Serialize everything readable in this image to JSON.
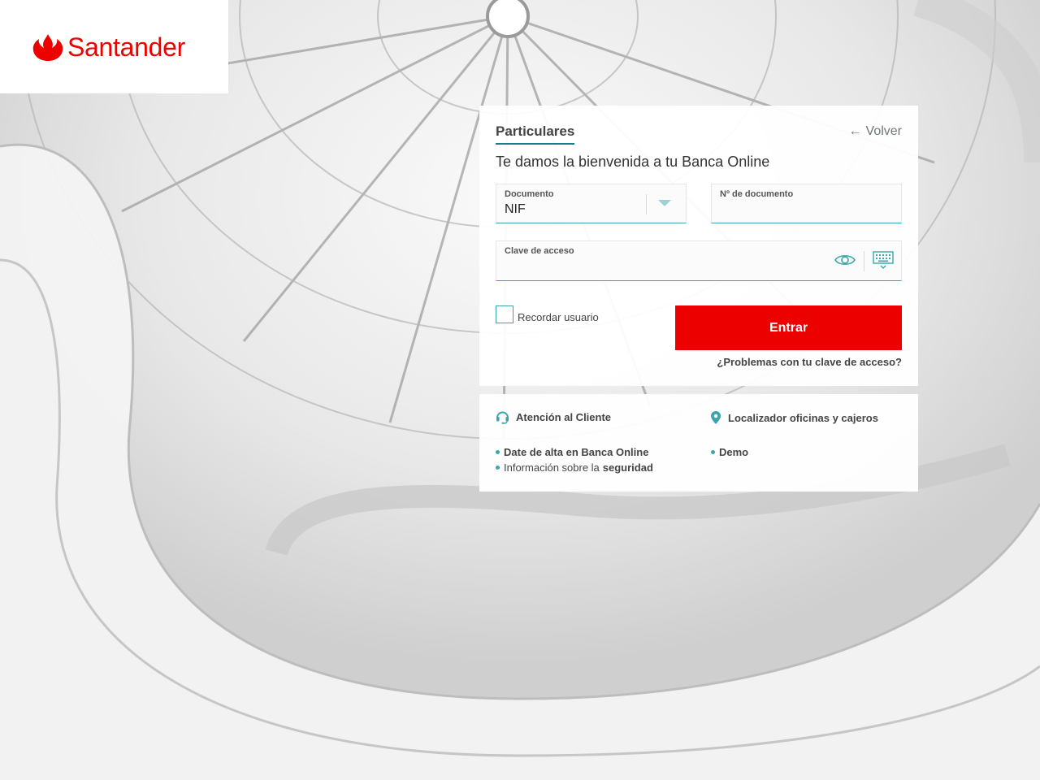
{
  "brand": {
    "name": "Santander",
    "color": "#ec0000"
  },
  "login": {
    "tab_label": "Particulares",
    "back_label": "Volver",
    "welcome": "Te damos la bienvenida a tu Banca Online",
    "document": {
      "label": "Documento",
      "value": "NIF"
    },
    "document_number": {
      "label": "Nº de documento",
      "value": ""
    },
    "password": {
      "label": "Clave de acceso",
      "value": ""
    },
    "remember_label": "Recordar usuario",
    "remember_checked": false,
    "submit_label": "Entrar",
    "forgot_label": "¿Problemas con tu clave de acceso?",
    "accent_color": "#3aa6ab"
  },
  "info": {
    "customer_care": "Atención al Cliente",
    "customer_care_icon": "headset-icon",
    "locator": "Localizador oficinas y cajeros",
    "locator_icon": "map-pin-icon",
    "signup": "Date de alta en Banca Online",
    "demo": "Demo",
    "security_prefix": "Información sobre la",
    "security_bold": "seguridad"
  }
}
